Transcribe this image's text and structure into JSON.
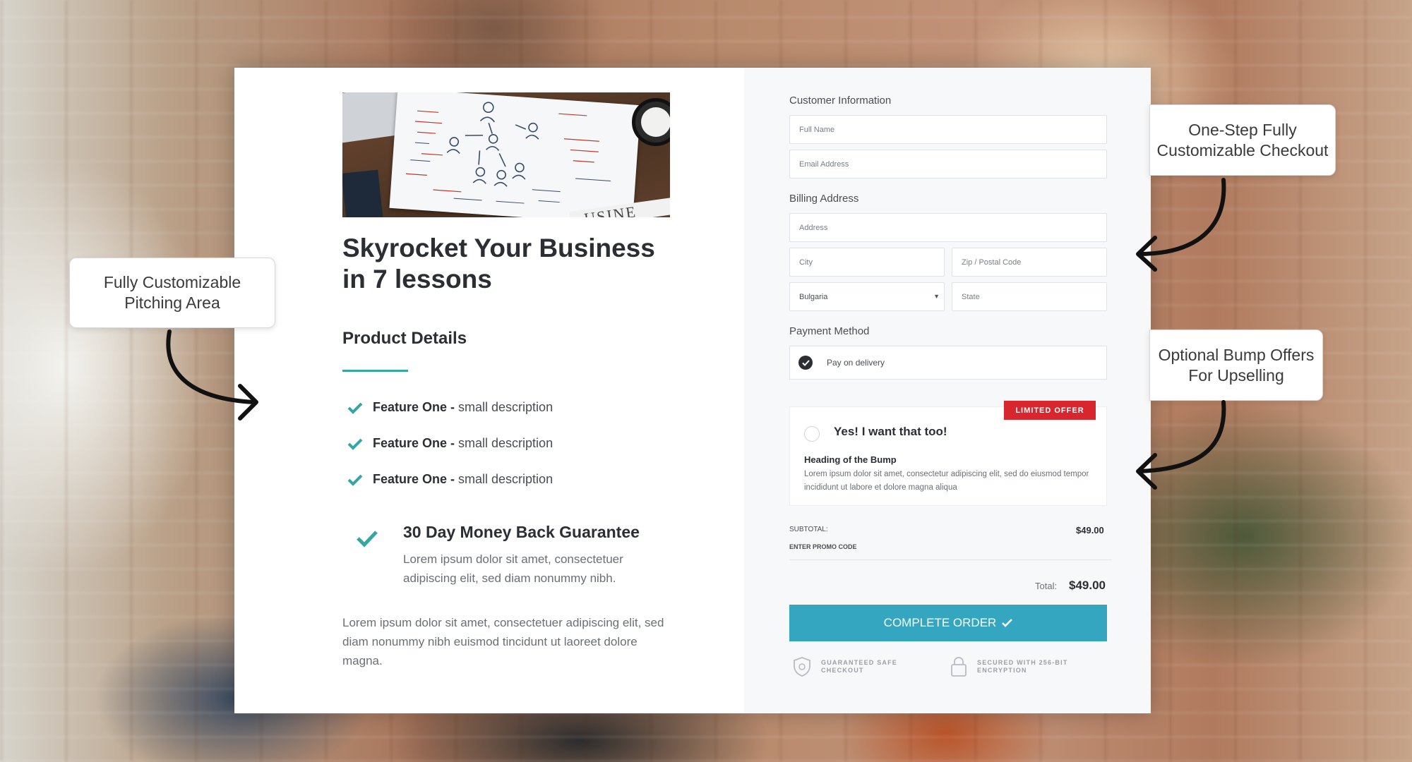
{
  "background": {
    "accent": "#34a6a4"
  },
  "pitch": {
    "image_note_text": "USINE",
    "title": "Skyrocket Your Business in 7 lessons",
    "product_details_heading": "Product Details",
    "features": [
      {
        "name": "Feature One",
        "separator": " - ",
        "desc": "small description"
      },
      {
        "name": "Feature One",
        "separator": " - ",
        "desc": "small description"
      },
      {
        "name": "Feature One",
        "separator": " - ",
        "desc": "small description"
      }
    ],
    "guarantee": {
      "title": "30 Day Money Back Guarantee",
      "desc": "Lorem ipsum dolor sit amet, consectetuer adipiscing elit, sed diam nonummy nibh."
    },
    "body_text": "Lorem ipsum dolor sit amet, consectetuer adipiscing elit, sed diam nonummy nibh euismod tincidunt ut laoreet dolore magna."
  },
  "checkout": {
    "customer_info_label": "Customer Information",
    "full_name_placeholder": "Full Name",
    "email_placeholder": "Email Address",
    "billing_label": "Billing Address",
    "address_placeholder": "Address",
    "city_placeholder": "City",
    "zip_placeholder": "Zip / Postal Code",
    "country_value": "Bulgaria",
    "state_placeholder": "State",
    "payment_label": "Payment Method",
    "payment_option": "Pay on delivery",
    "bump": {
      "badge": "LIMITED OFFER",
      "checkbox_label": "Yes! I want that too!",
      "heading": "Heading of the Bump",
      "desc": "Lorem ipsum dolor sit amet, consectetur adipiscing elit, sed do eiusmod tempor incididunt ut labore et dolore magna aliqua"
    },
    "subtotal_label": "SUBTOTAL:",
    "subtotal_value": "$49.00",
    "promo_label": "ENTER PROMO CODE",
    "total_label": "Total:",
    "total_value": "$49.00",
    "complete_button": "COMPLETE ORDER",
    "complete_color": "#35a6c0",
    "trust": [
      {
        "icon": "shield-icon",
        "line1": "GUARANTEED SAFE",
        "line2": "CHECKOUT"
      },
      {
        "icon": "lock-icon",
        "line1": "SECURED WITH 256-BIT",
        "line2": "ENCRYPTION"
      }
    ]
  },
  "callouts": {
    "pitching": "Fully Customizable Pitching Area",
    "checkout": "One-Step Fully Customizable Checkout",
    "bump": "Optional Bump Offers For Upselling"
  }
}
